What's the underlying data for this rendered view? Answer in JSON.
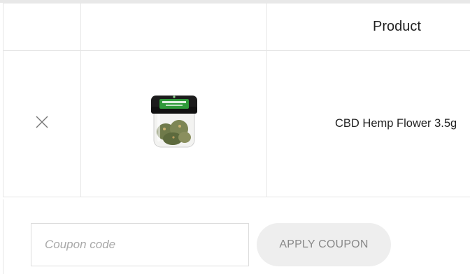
{
  "cart_table": {
    "header": {
      "product_label": "Product"
    },
    "items": [
      {
        "product_name": "CBD Hemp Flower 3.5g",
        "thumbnail_icon": "hemp-flower-jar-icon",
        "remove_icon": "close-icon"
      }
    ]
  },
  "coupon": {
    "placeholder": "Coupon code",
    "value": "",
    "apply_label": "APPLY COUPON"
  },
  "colors": {
    "border": "#e6e6e6",
    "button_bg": "#eeeeee",
    "button_text": "#888888",
    "jar_lid": "#1c1c1c",
    "jar_label_green": "#2f9a3a"
  }
}
